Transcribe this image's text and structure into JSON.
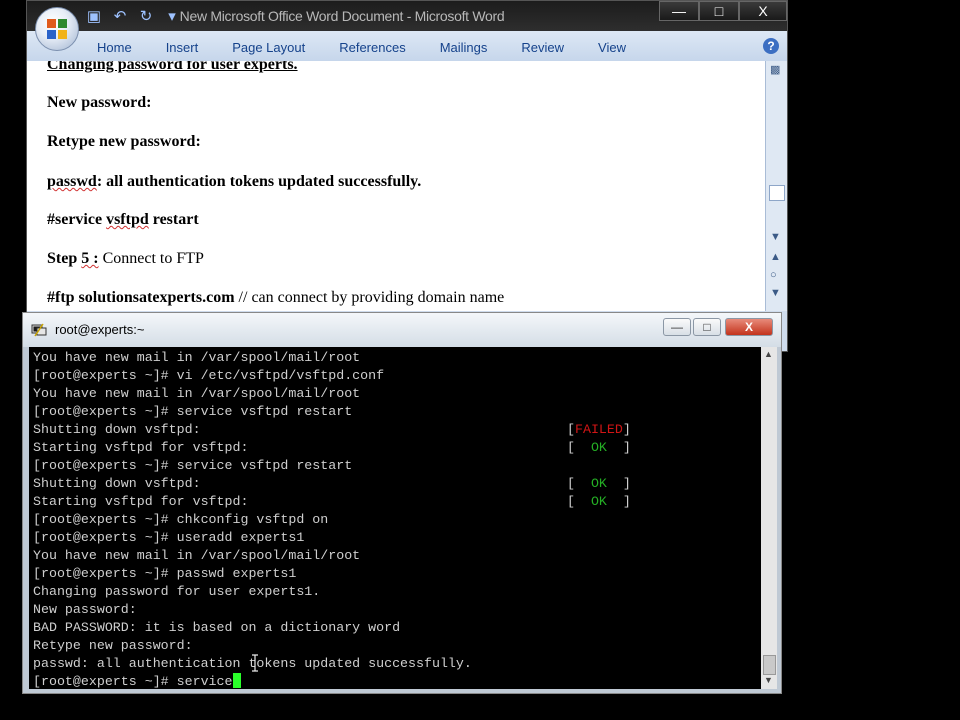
{
  "word": {
    "title": "New Microsoft Office Word Document - Microsoft Word",
    "window_buttons": {
      "minimize": "—",
      "maximize": "□",
      "close": "X"
    },
    "qat_icons": [
      "save-icon",
      "undo-icon",
      "redo-icon",
      "customize-qat-icon"
    ],
    "tabs": [
      "Home",
      "Insert",
      "Page Layout",
      "References",
      "Mailings",
      "Review",
      "View"
    ],
    "help": "?",
    "document": {
      "lines": [
        {
          "a": "Changing password for user experts."
        },
        {
          "a": "New password:"
        },
        {
          "a": "Retype new password:"
        },
        {
          "a": "passwd",
          "b": ": all authentication  tokens updated successfully."
        },
        {
          "a": "#service ",
          "b": "vsftpd",
          "c": " restart"
        },
        {
          "a": "Step ",
          "b": "5 :",
          "c": "   Connect to FTP"
        },
        {
          "a": "#ftp solutionsatexperts.com",
          "b": "        // can connect by providing domain name"
        }
      ]
    }
  },
  "terminal": {
    "title": "root@experts:~",
    "window_buttons": {
      "minimize": "—",
      "maximize": "□",
      "close": "X"
    },
    "lines": [
      "You have new mail in /var/spool/mail/root",
      "[root@experts ~]# vi /etc/vsftpd/vsftpd.conf",
      "You have new mail in /var/spool/mail/root",
      "[root@experts ~]# service vsftpd restart",
      "Shutting down vsftpd:",
      "Starting vsftpd for vsftpd:",
      "[root@experts ~]# service vsftpd restart",
      "Shutting down vsftpd:",
      "Starting vsftpd for vsftpd:",
      "[root@experts ~]# chkconfig vsftpd on",
      "[root@experts ~]# useradd experts1",
      "You have new mail in /var/spool/mail/root",
      "[root@experts ~]# passwd experts1",
      "Changing password for user experts1.",
      "New password:",
      "BAD PASSWORD: it is based on a dictionary word",
      "Retype new password:",
      "passwd: all authentication tokens updated successfully.",
      "[root@experts ~]# service"
    ],
    "statuses": [
      {
        "line": 4,
        "text": "FAILED",
        "state": "failed"
      },
      {
        "line": 5,
        "text": "OK",
        "state": "ok"
      },
      {
        "line": 7,
        "text": "OK",
        "state": "ok"
      },
      {
        "line": 8,
        "text": "OK",
        "state": "ok"
      }
    ],
    "colors": {
      "ok": "#25b025",
      "failed": "#d01515",
      "text": "#cfcfcf",
      "cursor": "#2aff2a"
    }
  }
}
